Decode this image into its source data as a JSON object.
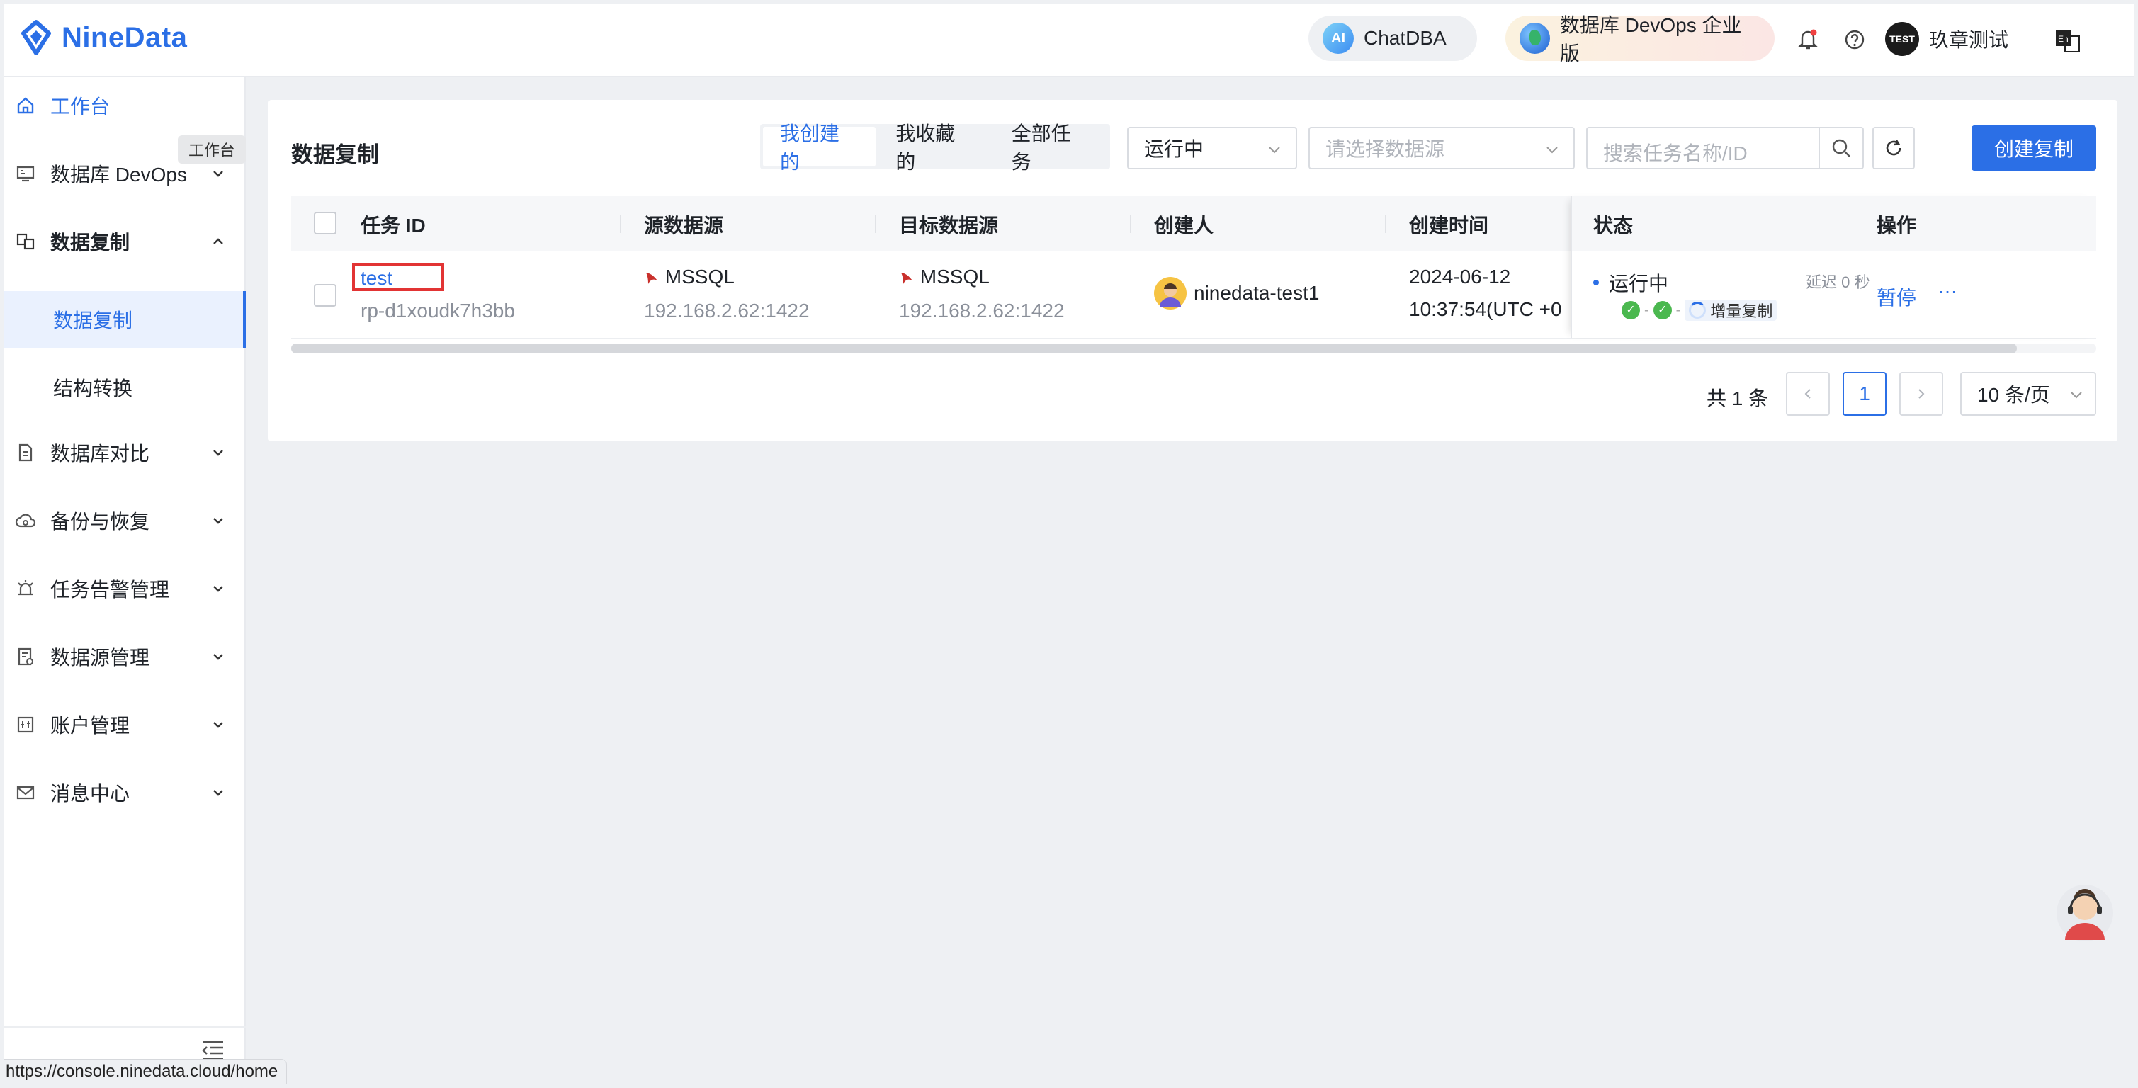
{
  "header": {
    "brand": "NineData",
    "chatdba_label": "ChatDBA",
    "chatdba_badge": "AI",
    "devops_label": "数据库 DevOps 企业版",
    "user_name": "玖章测试",
    "user_avatar_text": "TEST",
    "lang_icon_text": "En"
  },
  "sidebar": {
    "tooltip": "工作台",
    "items": [
      {
        "label": "工作台",
        "icon": "home-icon"
      },
      {
        "label": "数据库 DevOps",
        "icon": "monitor-icon"
      },
      {
        "label": "数据复制",
        "icon": "replication-icon"
      },
      {
        "label": "数据库对比",
        "icon": "document-compare-icon"
      },
      {
        "label": "备份与恢复",
        "icon": "cloud-backup-icon"
      },
      {
        "label": "任务告警管理",
        "icon": "alarm-icon"
      },
      {
        "label": "数据源管理",
        "icon": "datasource-icon"
      },
      {
        "label": "账户管理",
        "icon": "account-icon"
      },
      {
        "label": "消息中心",
        "icon": "mail-icon"
      }
    ],
    "sub_items": [
      "数据复制",
      "结构转换"
    ],
    "status_url": "https://console.ninedata.cloud/home"
  },
  "main": {
    "title": "数据复制",
    "tabs": [
      "我创建的",
      "我收藏的",
      "全部任务"
    ],
    "status_filter": "运行中",
    "source_placeholder": "请选择数据源",
    "search_placeholder": "搜索任务名称/ID",
    "create_button": "创建复制",
    "columns": [
      "任务 ID",
      "源数据源",
      "目标数据源",
      "创建人",
      "创建时间",
      "状态",
      "操作"
    ],
    "rows": [
      {
        "task_name": "test",
        "task_id": "rp-d1xoudk7h3bb",
        "source_type": "MSSQL",
        "source_addr": "192.168.2.62:1422",
        "target_type": "MSSQL",
        "target_addr": "192.168.2.62:1422",
        "creator": "ninedata-test1",
        "created_date": "2024-06-12",
        "created_time": "10:37:54(UTC +0",
        "status": "运行中",
        "delay": "延迟  0 秒",
        "stage": "增量复制",
        "action_pause": "暂停",
        "action_more": "···"
      }
    ]
  },
  "pagination": {
    "total": "共 1 条",
    "current_page": "1",
    "page_size": "10 条/页"
  },
  "colors": {
    "accent": "#2b6fe6",
    "highlight_box": "#e23434",
    "success": "#4bb84f"
  }
}
